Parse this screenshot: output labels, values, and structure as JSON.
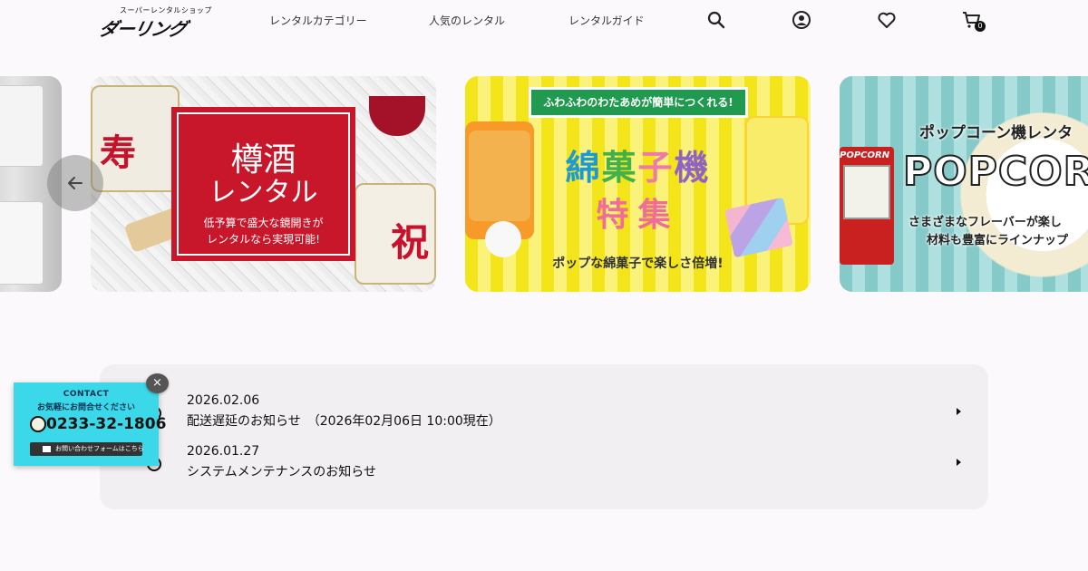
{
  "header": {
    "logo_tagline": "スーパーレンタルショップ",
    "logo_name": "ダーリング",
    "nav": [
      {
        "label": "レンタルカテゴリー"
      },
      {
        "label": "人気のレンタル"
      },
      {
        "label": "レンタルガイド"
      }
    ],
    "cart_count": "0"
  },
  "carousel": {
    "slides": [
      {
        "name": "purifier",
        "title": ""
      },
      {
        "name": "taru-sake",
        "title": "樽酒",
        "subtitle": "レンタル",
        "line1": "低予算で盛大な鏡開きが",
        "line2": "レンタルなら実現可能!",
        "decor_left": "寿",
        "decor_right": "祝",
        "accent": "#c8172b"
      },
      {
        "name": "cotton-candy",
        "banner": "ふわふわのわたあめが簡単につくれる!",
        "title_chars": [
          "綿",
          "菓",
          "子",
          "機"
        ],
        "subtitle": "特集",
        "footer": "ポップな綿菓子で楽しさ倍増!",
        "accent": "#f4e41a"
      },
      {
        "name": "popcorn",
        "headline": "ポップコーン機レンタ",
        "big": "POPCORN",
        "machine_label": "POPCORN",
        "line1": "さまざまなフレーバーが楽し",
        "line2": "材料も豊富にラインナップ",
        "accent": "#85c9c9"
      }
    ]
  },
  "news": {
    "items": [
      {
        "date": "2026.02.06",
        "title": "配送遅延のお知らせ　（2026年02月06日 10:00現在）"
      },
      {
        "date": "2026.01.27",
        "title": "システムメンテナンスのお知らせ"
      }
    ]
  },
  "contact_popup": {
    "heading": "CONTACT",
    "subheading": "お気軽にお問合せください",
    "phone": "0233-32-1806",
    "form_label": "お問い合わせフォームはこちら",
    "close": "×",
    "accent": "#3ad8e8"
  }
}
